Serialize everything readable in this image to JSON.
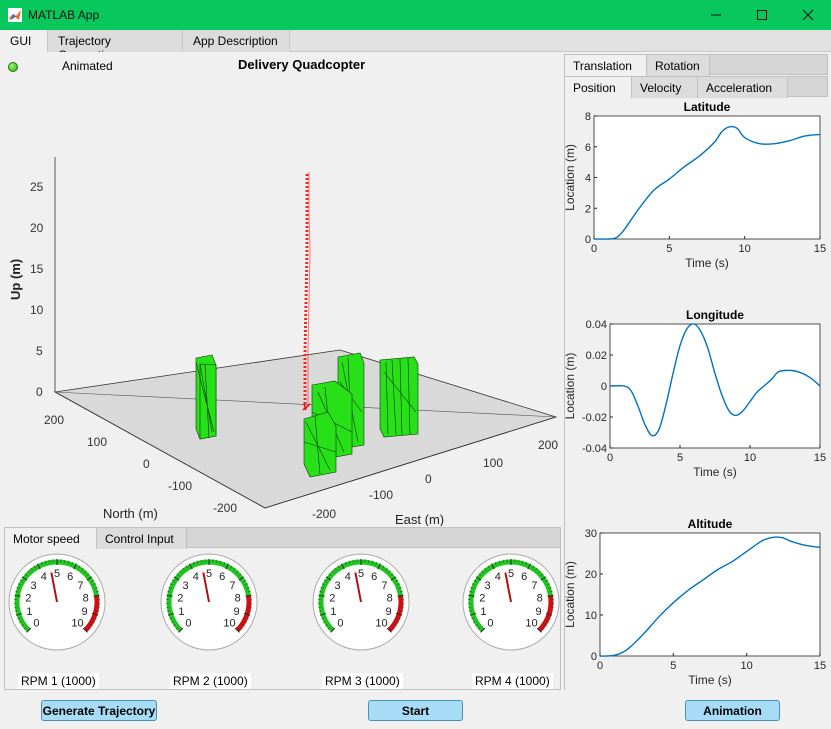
{
  "window": {
    "title": "MATLAB App",
    "icon": "matlab-icon",
    "controls": [
      "minimize-icon",
      "maximize-icon",
      "close-icon"
    ]
  },
  "tabs": [
    {
      "label": "GUI",
      "active": true
    },
    {
      "label": "Trajectory Generation",
      "active": false
    },
    {
      "label": "App Description",
      "active": false
    }
  ],
  "lamp": {
    "label": "Animated",
    "color": "#28b10b"
  },
  "main_plot": {
    "title": "Delivery Quadcopter",
    "zlabel": "Up (m)",
    "xlabel": "North (m)",
    "ylabel": "East (m)",
    "z_ticks": [
      "0",
      "5",
      "10",
      "15",
      "20",
      "25"
    ],
    "north_ticks": [
      "200",
      "100",
      "0",
      "-100",
      "-200"
    ],
    "east_ticks": [
      "-200",
      "-100",
      "0",
      "100",
      "200"
    ]
  },
  "right_tabs": {
    "top": [
      {
        "label": "Translation",
        "active": true
      },
      {
        "label": "Rotation",
        "active": false
      }
    ],
    "sub": [
      {
        "label": "Position",
        "active": true
      },
      {
        "label": "Velocity",
        "active": false
      },
      {
        "label": "Acceleration",
        "active": false
      }
    ]
  },
  "bottom_tabs": [
    {
      "label": "Motor speed",
      "active": true
    },
    {
      "label": "Control Input",
      "active": false
    }
  ],
  "gauges": [
    {
      "label": "RPM 1 (1000)",
      "value": 4.6
    },
    {
      "label": "RPM 2 (1000)",
      "value": 4.6
    },
    {
      "label": "RPM 3 (1000)",
      "value": 4.6
    },
    {
      "label": "RPM 4 (1000)",
      "value": 4.6
    }
  ],
  "gauge_ticks": [
    "0",
    "1",
    "2",
    "3",
    "4",
    "5",
    "6",
    "7",
    "8",
    "9",
    "10"
  ],
  "buttons": {
    "generate": "Generate Trajectory",
    "start": "Start",
    "animation": "Animation"
  },
  "chart_data": [
    {
      "type": "line",
      "title": "Latitude",
      "xlabel": "Time (s)",
      "ylabel": "Location (m)",
      "xlim": [
        0,
        15
      ],
      "ylim": [
        0,
        8
      ],
      "xticks": [
        "0",
        "5",
        "10",
        "15"
      ],
      "yticks": [
        "0",
        "2",
        "4",
        "6",
        "8"
      ],
      "x": [
        0,
        1,
        1.5,
        2,
        3,
        4,
        5,
        6,
        7,
        8,
        8.5,
        9,
        9.5,
        10,
        11,
        12,
        13,
        14,
        15
      ],
      "y": [
        0,
        0,
        0.1,
        0.6,
        2.0,
        3.2,
        3.9,
        4.7,
        5.4,
        6.3,
        7.0,
        7.3,
        7.2,
        6.6,
        6.2,
        6.2,
        6.4,
        6.7,
        6.8
      ]
    },
    {
      "type": "line",
      "title": "Longitude",
      "xlabel": "Time (s)",
      "ylabel": "Location (m)",
      "xlim": [
        0,
        15
      ],
      "ylim": [
        -0.04,
        0.04
      ],
      "xticks": [
        "0",
        "5",
        "10",
        "15"
      ],
      "yticks": [
        "0.04",
        "0.02",
        "0",
        "-0.02",
        "-0.04"
      ],
      "x": [
        0,
        1,
        1.5,
        2,
        2.5,
        3,
        3.5,
        4,
        4.5,
        5,
        5.5,
        6,
        6.5,
        7,
        7.5,
        8,
        8.5,
        9,
        9.5,
        10,
        10.5,
        11,
        11.5,
        12,
        12.5,
        13,
        13.5,
        14,
        14.5,
        15
      ],
      "y": [
        0,
        0,
        -0.003,
        -0.013,
        -0.025,
        -0.032,
        -0.028,
        -0.012,
        0.008,
        0.026,
        0.037,
        0.04,
        0.035,
        0.024,
        0.008,
        -0.006,
        -0.016,
        -0.019,
        -0.016,
        -0.01,
        -0.004,
        0.0,
        0.004,
        0.009,
        0.01,
        0.01,
        0.009,
        0.007,
        0.004,
        0.0
      ]
    },
    {
      "type": "line",
      "title": "Altitude",
      "xlabel": "Time (s)",
      "ylabel": "Location (m)",
      "xlim": [
        0,
        15
      ],
      "ylim": [
        0,
        30
      ],
      "xticks": [
        "0",
        "5",
        "10",
        "15"
      ],
      "yticks": [
        "0",
        "10",
        "20",
        "30"
      ],
      "x": [
        0,
        0.5,
        1,
        1.5,
        2,
        3,
        4,
        5,
        6,
        7,
        8,
        9,
        10,
        11,
        11.5,
        12,
        12.5,
        13,
        14,
        15
      ],
      "y": [
        0,
        0,
        0.2,
        0.8,
        2.0,
        5.5,
        9.5,
        13.0,
        16.0,
        18.5,
        21.0,
        23.0,
        25.5,
        28.0,
        28.7,
        29.0,
        28.8,
        28.0,
        27.0,
        26.5
      ]
    }
  ]
}
